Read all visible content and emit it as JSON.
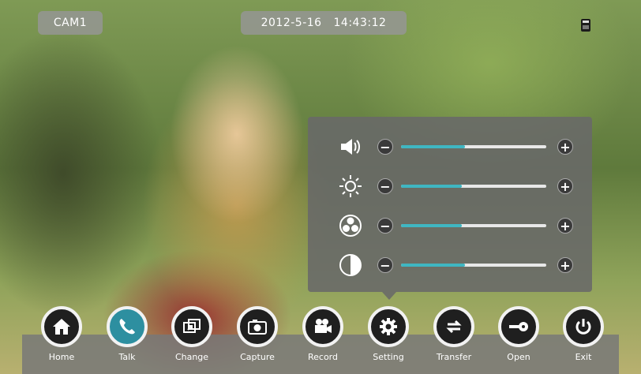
{
  "camera_label": "CAM1",
  "datetime": "2012-5-16   14:43:12",
  "settings_panel": {
    "sliders": [
      {
        "name": "volume",
        "icon": "speaker-icon",
        "value": 0.44
      },
      {
        "name": "brightness",
        "icon": "sun-icon",
        "value": 0.42
      },
      {
        "name": "color",
        "icon": "color-wheel-icon",
        "value": 0.42
      },
      {
        "name": "contrast",
        "icon": "contrast-icon",
        "value": 0.44
      }
    ],
    "minus_label": "−",
    "plus_label": "+"
  },
  "toolbar": {
    "active": "Talk",
    "items": [
      {
        "label": "Home",
        "icon": "home-icon"
      },
      {
        "label": "Talk",
        "icon": "phone-icon"
      },
      {
        "label": "Change",
        "icon": "switch-windows-icon"
      },
      {
        "label": "Capture",
        "icon": "camera-icon"
      },
      {
        "label": "Record",
        "icon": "video-camera-icon"
      },
      {
        "label": "Setting",
        "icon": "gear-icon"
      },
      {
        "label": "Transfer",
        "icon": "transfer-arrows-icon"
      },
      {
        "label": "Open",
        "icon": "key-icon"
      },
      {
        "label": "Exit",
        "icon": "power-icon"
      }
    ]
  },
  "colors": {
    "accent": "#3fb6c2",
    "active_button": "#2d8fa0"
  }
}
